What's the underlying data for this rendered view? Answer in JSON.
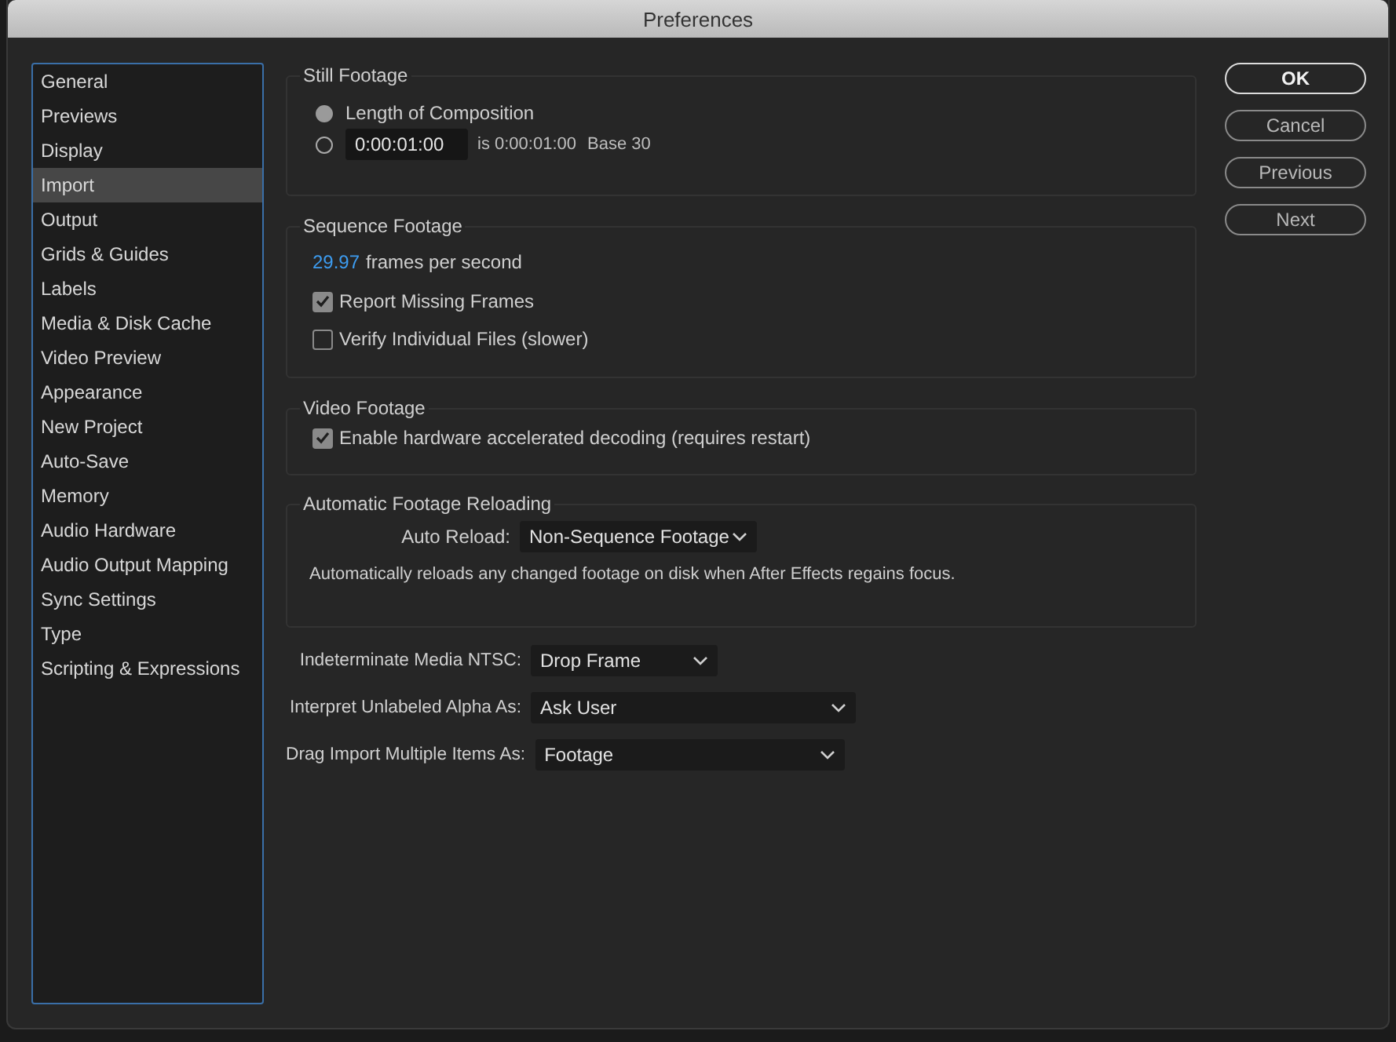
{
  "window": {
    "title": "Preferences"
  },
  "sidebar": {
    "items": [
      {
        "label": "General",
        "selected": false
      },
      {
        "label": "Previews",
        "selected": false
      },
      {
        "label": "Display",
        "selected": false
      },
      {
        "label": "Import",
        "selected": true
      },
      {
        "label": "Output",
        "selected": false
      },
      {
        "label": "Grids & Guides",
        "selected": false
      },
      {
        "label": "Labels",
        "selected": false
      },
      {
        "label": "Media & Disk Cache",
        "selected": false
      },
      {
        "label": "Video Preview",
        "selected": false
      },
      {
        "label": "Appearance",
        "selected": false
      },
      {
        "label": "New Project",
        "selected": false
      },
      {
        "label": "Auto-Save",
        "selected": false
      },
      {
        "label": "Memory",
        "selected": false
      },
      {
        "label": "Audio Hardware",
        "selected": false
      },
      {
        "label": "Audio Output Mapping",
        "selected": false
      },
      {
        "label": "Sync Settings",
        "selected": false
      },
      {
        "label": "Type",
        "selected": false
      },
      {
        "label": "Scripting & Expressions",
        "selected": false
      }
    ]
  },
  "still_footage": {
    "title": "Still Footage",
    "options": [
      {
        "kind": "label",
        "label": "Length of Composition",
        "selected": true
      },
      {
        "kind": "duration",
        "value": "0:00:01:00",
        "note": "is 0:00:01:00",
        "base": "Base 30",
        "selected": false
      }
    ]
  },
  "sequence_footage": {
    "title": "Sequence Footage",
    "rate": "29.97",
    "rate_suffix": "frames per second",
    "checkboxes": [
      {
        "label": "Report Missing Frames",
        "checked": true
      },
      {
        "label": "Verify Individual Files (slower)",
        "checked": false
      }
    ]
  },
  "video_footage": {
    "title": "Video Footage",
    "checkboxes": [
      {
        "label": "Enable hardware accelerated decoding (requires restart)",
        "checked": true
      }
    ]
  },
  "automatic_reloading": {
    "title": "Automatic Footage Reloading",
    "label": "Auto Reload:",
    "value": "Non-Sequence Footage",
    "description": "Automatically reloads any changed footage on disk when After Effects regains focus."
  },
  "settings": [
    {
      "label": "Indeterminate Media NTSC:",
      "value": "Drop Frame"
    },
    {
      "label": "Interpret Unlabeled Alpha As:",
      "value": "Ask User"
    },
    {
      "label": "Drag Import Multiple Items As:",
      "value": "Footage"
    }
  ],
  "buttons": [
    {
      "label": "OK",
      "default": true
    },
    {
      "label": "Cancel",
      "default": false
    },
    {
      "label": "Previous",
      "default": false
    },
    {
      "label": "Next",
      "default": false
    }
  ]
}
